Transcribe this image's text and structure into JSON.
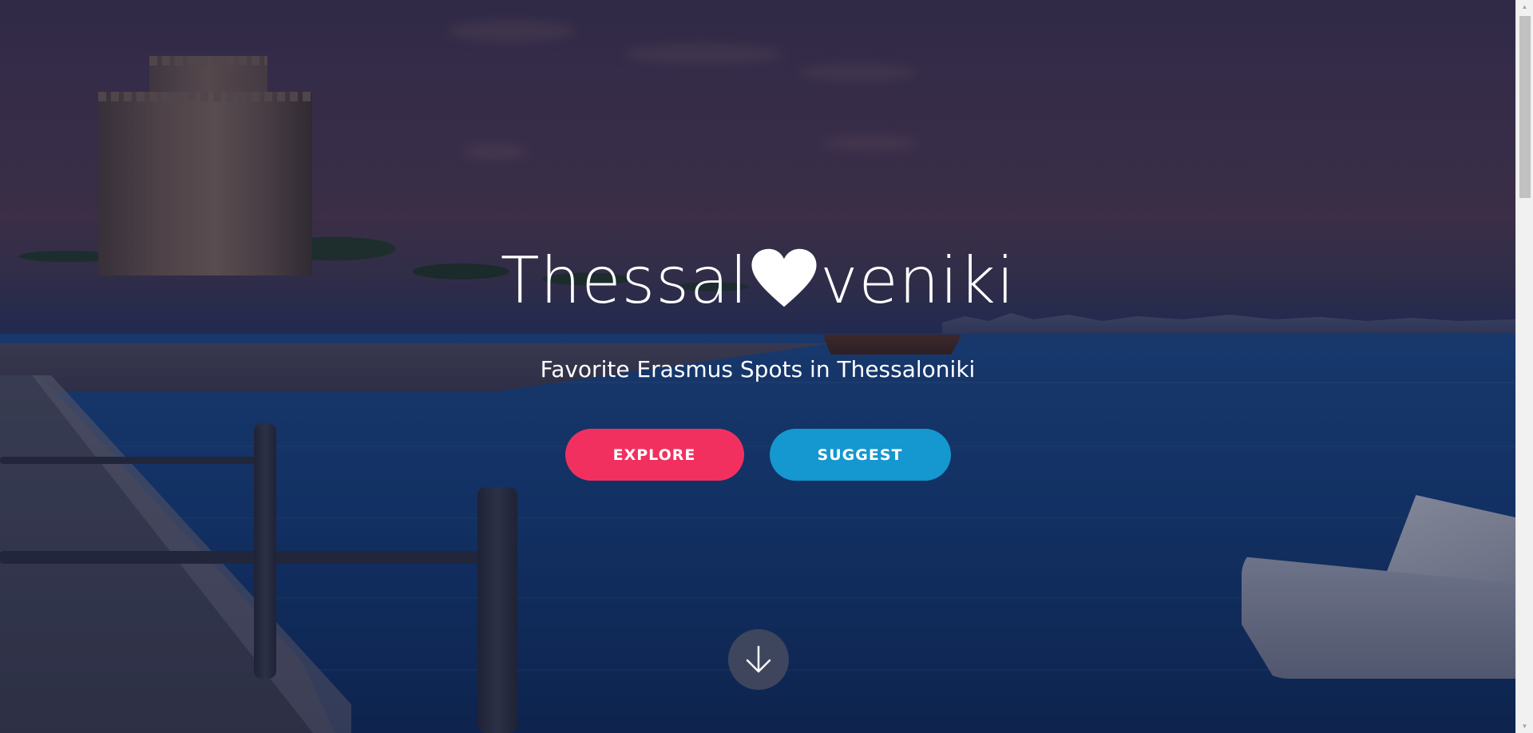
{
  "hero": {
    "brand_prefix": "Thessal",
    "brand_suffix": "veniki",
    "brand_heart_icon": "heart-icon",
    "tagline": "Favorite Erasmus Spots in Thessaloniki"
  },
  "actions": {
    "explore_label": "EXPLORE",
    "suggest_label": "SUGGEST"
  },
  "scroll": {
    "down_icon": "arrow-down-icon"
  },
  "colors": {
    "explore": "#f2305f",
    "suggest": "#1597cf",
    "text": "#ffffff"
  }
}
